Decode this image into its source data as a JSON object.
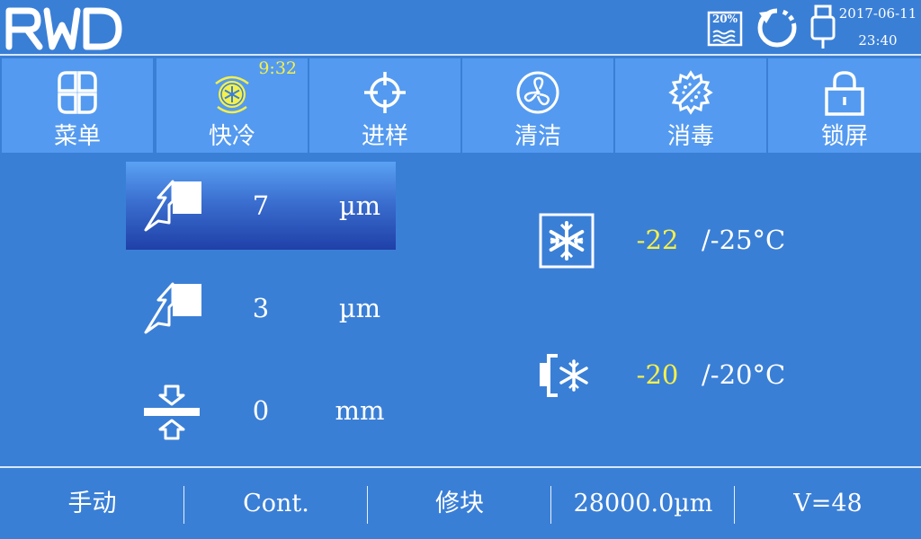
{
  "header": {
    "brand": "RWD",
    "ink_level": "20%",
    "date": "2017-06-11",
    "time": "23:40"
  },
  "toolbar": {
    "items": [
      {
        "label": "菜单",
        "icon": "menu-grid-icon"
      },
      {
        "label": "快冷",
        "icon": "quick-freeze-icon",
        "timer": "9:32"
      },
      {
        "label": "进样",
        "icon": "crosshair-icon"
      },
      {
        "label": "清洁",
        "icon": "fan-icon"
      },
      {
        "label": "消毒",
        "icon": "disinfect-icon"
      },
      {
        "label": "锁屏",
        "icon": "lock-icon"
      }
    ]
  },
  "sections": {
    "rows": [
      {
        "value": "7",
        "unit": "µm",
        "icon": "trim-thickness-icon",
        "selected": true
      },
      {
        "value": "3",
        "unit": "µm",
        "icon": "section-thickness-icon",
        "selected": false
      },
      {
        "value": "0",
        "unit": "mm",
        "icon": "retract-icon",
        "selected": false
      }
    ]
  },
  "temperatures": [
    {
      "current": "-22",
      "setpoint": "/-25°C",
      "icon": "chamber-freeze-icon"
    },
    {
      "current": "-20",
      "setpoint": "/-20°C",
      "icon": "specimen-freeze-icon"
    }
  ],
  "footer": {
    "mode": "手动",
    "cut": "Cont.",
    "function": "修块",
    "position": "28000.0µm",
    "speed": "V=48"
  },
  "colors": {
    "background": "#3a7fd6",
    "button": "#549af0",
    "highlight_text": "#f5f04a",
    "selected_top": "#5aa2f4",
    "selected_bottom": "#1f40a8"
  }
}
